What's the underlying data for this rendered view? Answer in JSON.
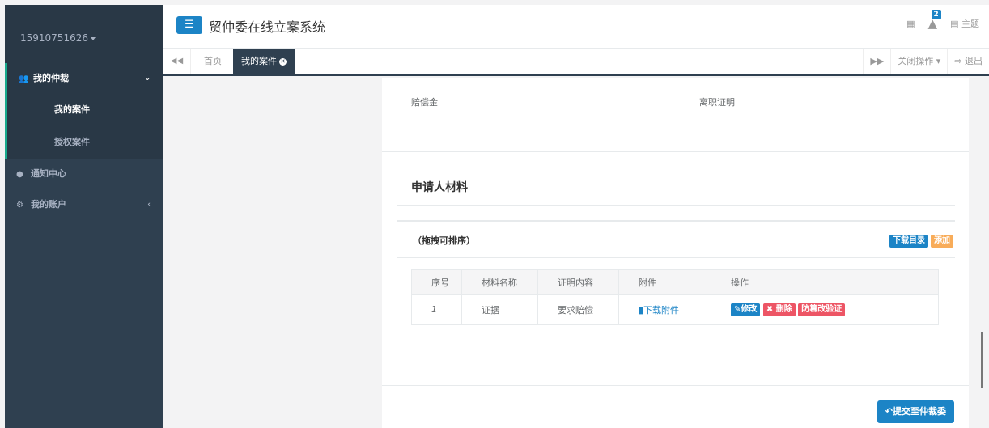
{
  "app": {
    "title": "贸仲委在线立案系统",
    "menu_icon": "hamburger-icon"
  },
  "user": {
    "phone": "15910751626"
  },
  "header": {
    "notification_count": "2",
    "theme_label": "主题"
  },
  "sidebar": {
    "groups": [
      {
        "label": "我的仲裁",
        "icon": "users-icon",
        "expanded": true,
        "children": [
          {
            "label": "我的案件"
          },
          {
            "label": "授权案件"
          }
        ]
      },
      {
        "label": "通知中心",
        "icon": "comment-icon"
      },
      {
        "label": "我的账户",
        "icon": "gear-icon"
      }
    ]
  },
  "tabs": {
    "items": [
      {
        "label": "首页"
      },
      {
        "label": "我的案件"
      }
    ],
    "close_ops_label": "关闭操作",
    "logout_label": "退出"
  },
  "main": {
    "field_left": "赔偿金",
    "field_right": "离职证明",
    "section_title": "申请人材料",
    "box_title": "（拖拽可排序）",
    "download_catalog": "下载目录",
    "add_label": "添加",
    "table": {
      "headers": [
        "序号",
        "材料名称",
        "证明内容",
        "附件",
        "操作"
      ],
      "rows": [
        {
          "no": "1",
          "name": "证据",
          "content": "要求赔偿",
          "attachment": "下载附件"
        }
      ]
    },
    "actions": {
      "edit": "修改",
      "delete": "删除",
      "tamper": "防篡改验证"
    },
    "submit_label": "提交至仲裁委"
  },
  "colors": {
    "sidebar": "#2f4050",
    "accent": "#1c84c6",
    "danger": "#ed5565",
    "warning": "#f8ac59",
    "active_border": "#19aa8d"
  }
}
